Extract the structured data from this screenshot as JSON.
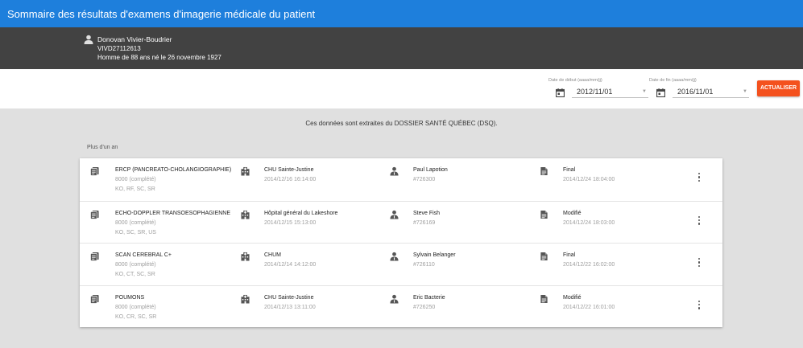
{
  "header": {
    "title": "Sommaire des résultats d'examens d'imagerie médicale du patient"
  },
  "patient": {
    "icon": "person-icon",
    "name": "Donovan Vivier-Boudrier",
    "id": "VIVD27112613",
    "description": "Homme de 88 ans né le 26 novembre 1927"
  },
  "filters": {
    "start_label": "Date de début (aaaa/mm/jj)",
    "start_value": "2012/11/01",
    "end_label": "Date de fin (aaaa/mm/jj)",
    "end_value": "2016/11/01",
    "refresh_label": "ACTUALISER",
    "accent_color": "#f4511e"
  },
  "source_note": "Ces données sont extraites du DOSSIER SANTÉ QUÉBEC (DSQ).",
  "section_label": "Plus d'un an",
  "exams": [
    {
      "exam": "ERCP (PANCREATO-CHOLANGIOGRAPHIE)",
      "status": "8000 (complété)",
      "modalities": "KO, RF, SC, SR",
      "facility": "CHU Sainte-Justine",
      "exam_date": "2014/12/16 16:14:00",
      "doctor": "Paul Lapotion",
      "doctor_id": "#726300",
      "report_status": "Final",
      "report_date": "2014/12/24 18:04:00"
    },
    {
      "exam": "ECHO-DOPPLER TRANSOESOPHAGIENNE",
      "status": "8000 (complété)",
      "modalities": "KO, SC, SR, US",
      "facility": "Hôpital général du Lakeshore",
      "exam_date": "2014/12/15 15:13:00",
      "doctor": "Steve Fish",
      "doctor_id": "#726169",
      "report_status": "Modifié",
      "report_date": "2014/12/24 18:03:00"
    },
    {
      "exam": "SCAN CEREBRAL C+",
      "status": "8000 (complété)",
      "modalities": "KO, CT, SC, SR",
      "facility": "CHUM",
      "exam_date": "2014/12/14 14:12:00",
      "doctor": "Sylvain Belanger",
      "doctor_id": "#726110",
      "report_status": "Final",
      "report_date": "2014/12/22 16:02:00"
    },
    {
      "exam": "POUMONS",
      "status": "8000 (complété)",
      "modalities": "KO, CR, SC, SR",
      "facility": "CHU Sainte-Justine",
      "exam_date": "2014/12/13 13:11:00",
      "doctor": "Eric Bacterie",
      "doctor_id": "#726250",
      "report_status": "Modifié",
      "report_date": "2014/12/22 16:01:00"
    }
  ]
}
